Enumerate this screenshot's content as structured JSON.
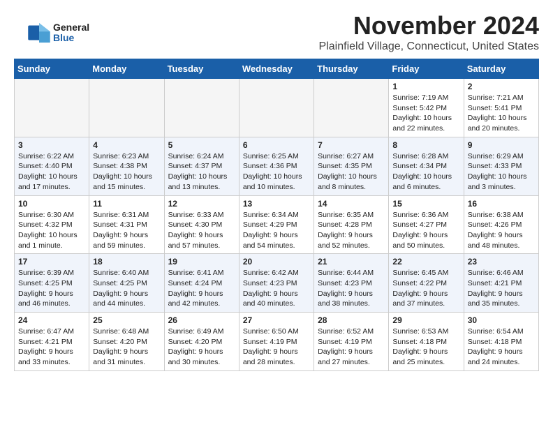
{
  "logo": {
    "general": "General",
    "blue": "Blue"
  },
  "header": {
    "month_year": "November 2024",
    "location": "Plainfield Village, Connecticut, United States"
  },
  "weekdays": [
    "Sunday",
    "Monday",
    "Tuesday",
    "Wednesday",
    "Thursday",
    "Friday",
    "Saturday"
  ],
  "weeks": [
    [
      {
        "day": "",
        "info": ""
      },
      {
        "day": "",
        "info": ""
      },
      {
        "day": "",
        "info": ""
      },
      {
        "day": "",
        "info": ""
      },
      {
        "day": "",
        "info": ""
      },
      {
        "day": "1",
        "info": "Sunrise: 7:19 AM\nSunset: 5:42 PM\nDaylight: 10 hours\nand 22 minutes."
      },
      {
        "day": "2",
        "info": "Sunrise: 7:21 AM\nSunset: 5:41 PM\nDaylight: 10 hours\nand 20 minutes."
      }
    ],
    [
      {
        "day": "3",
        "info": "Sunrise: 6:22 AM\nSunset: 4:40 PM\nDaylight: 10 hours\nand 17 minutes."
      },
      {
        "day": "4",
        "info": "Sunrise: 6:23 AM\nSunset: 4:38 PM\nDaylight: 10 hours\nand 15 minutes."
      },
      {
        "day": "5",
        "info": "Sunrise: 6:24 AM\nSunset: 4:37 PM\nDaylight: 10 hours\nand 13 minutes."
      },
      {
        "day": "6",
        "info": "Sunrise: 6:25 AM\nSunset: 4:36 PM\nDaylight: 10 hours\nand 10 minutes."
      },
      {
        "day": "7",
        "info": "Sunrise: 6:27 AM\nSunset: 4:35 PM\nDaylight: 10 hours\nand 8 minutes."
      },
      {
        "day": "8",
        "info": "Sunrise: 6:28 AM\nSunset: 4:34 PM\nDaylight: 10 hours\nand 6 minutes."
      },
      {
        "day": "9",
        "info": "Sunrise: 6:29 AM\nSunset: 4:33 PM\nDaylight: 10 hours\nand 3 minutes."
      }
    ],
    [
      {
        "day": "10",
        "info": "Sunrise: 6:30 AM\nSunset: 4:32 PM\nDaylight: 10 hours\nand 1 minute."
      },
      {
        "day": "11",
        "info": "Sunrise: 6:31 AM\nSunset: 4:31 PM\nDaylight: 9 hours\nand 59 minutes."
      },
      {
        "day": "12",
        "info": "Sunrise: 6:33 AM\nSunset: 4:30 PM\nDaylight: 9 hours\nand 57 minutes."
      },
      {
        "day": "13",
        "info": "Sunrise: 6:34 AM\nSunset: 4:29 PM\nDaylight: 9 hours\nand 54 minutes."
      },
      {
        "day": "14",
        "info": "Sunrise: 6:35 AM\nSunset: 4:28 PM\nDaylight: 9 hours\nand 52 minutes."
      },
      {
        "day": "15",
        "info": "Sunrise: 6:36 AM\nSunset: 4:27 PM\nDaylight: 9 hours\nand 50 minutes."
      },
      {
        "day": "16",
        "info": "Sunrise: 6:38 AM\nSunset: 4:26 PM\nDaylight: 9 hours\nand 48 minutes."
      }
    ],
    [
      {
        "day": "17",
        "info": "Sunrise: 6:39 AM\nSunset: 4:25 PM\nDaylight: 9 hours\nand 46 minutes."
      },
      {
        "day": "18",
        "info": "Sunrise: 6:40 AM\nSunset: 4:25 PM\nDaylight: 9 hours\nand 44 minutes."
      },
      {
        "day": "19",
        "info": "Sunrise: 6:41 AM\nSunset: 4:24 PM\nDaylight: 9 hours\nand 42 minutes."
      },
      {
        "day": "20",
        "info": "Sunrise: 6:42 AM\nSunset: 4:23 PM\nDaylight: 9 hours\nand 40 minutes."
      },
      {
        "day": "21",
        "info": "Sunrise: 6:44 AM\nSunset: 4:23 PM\nDaylight: 9 hours\nand 38 minutes."
      },
      {
        "day": "22",
        "info": "Sunrise: 6:45 AM\nSunset: 4:22 PM\nDaylight: 9 hours\nand 37 minutes."
      },
      {
        "day": "23",
        "info": "Sunrise: 6:46 AM\nSunset: 4:21 PM\nDaylight: 9 hours\nand 35 minutes."
      }
    ],
    [
      {
        "day": "24",
        "info": "Sunrise: 6:47 AM\nSunset: 4:21 PM\nDaylight: 9 hours\nand 33 minutes."
      },
      {
        "day": "25",
        "info": "Sunrise: 6:48 AM\nSunset: 4:20 PM\nDaylight: 9 hours\nand 31 minutes."
      },
      {
        "day": "26",
        "info": "Sunrise: 6:49 AM\nSunset: 4:20 PM\nDaylight: 9 hours\nand 30 minutes."
      },
      {
        "day": "27",
        "info": "Sunrise: 6:50 AM\nSunset: 4:19 PM\nDaylight: 9 hours\nand 28 minutes."
      },
      {
        "day": "28",
        "info": "Sunrise: 6:52 AM\nSunset: 4:19 PM\nDaylight: 9 hours\nand 27 minutes."
      },
      {
        "day": "29",
        "info": "Sunrise: 6:53 AM\nSunset: 4:18 PM\nDaylight: 9 hours\nand 25 minutes."
      },
      {
        "day": "30",
        "info": "Sunrise: 6:54 AM\nSunset: 4:18 PM\nDaylight: 9 hours\nand 24 minutes."
      }
    ]
  ]
}
